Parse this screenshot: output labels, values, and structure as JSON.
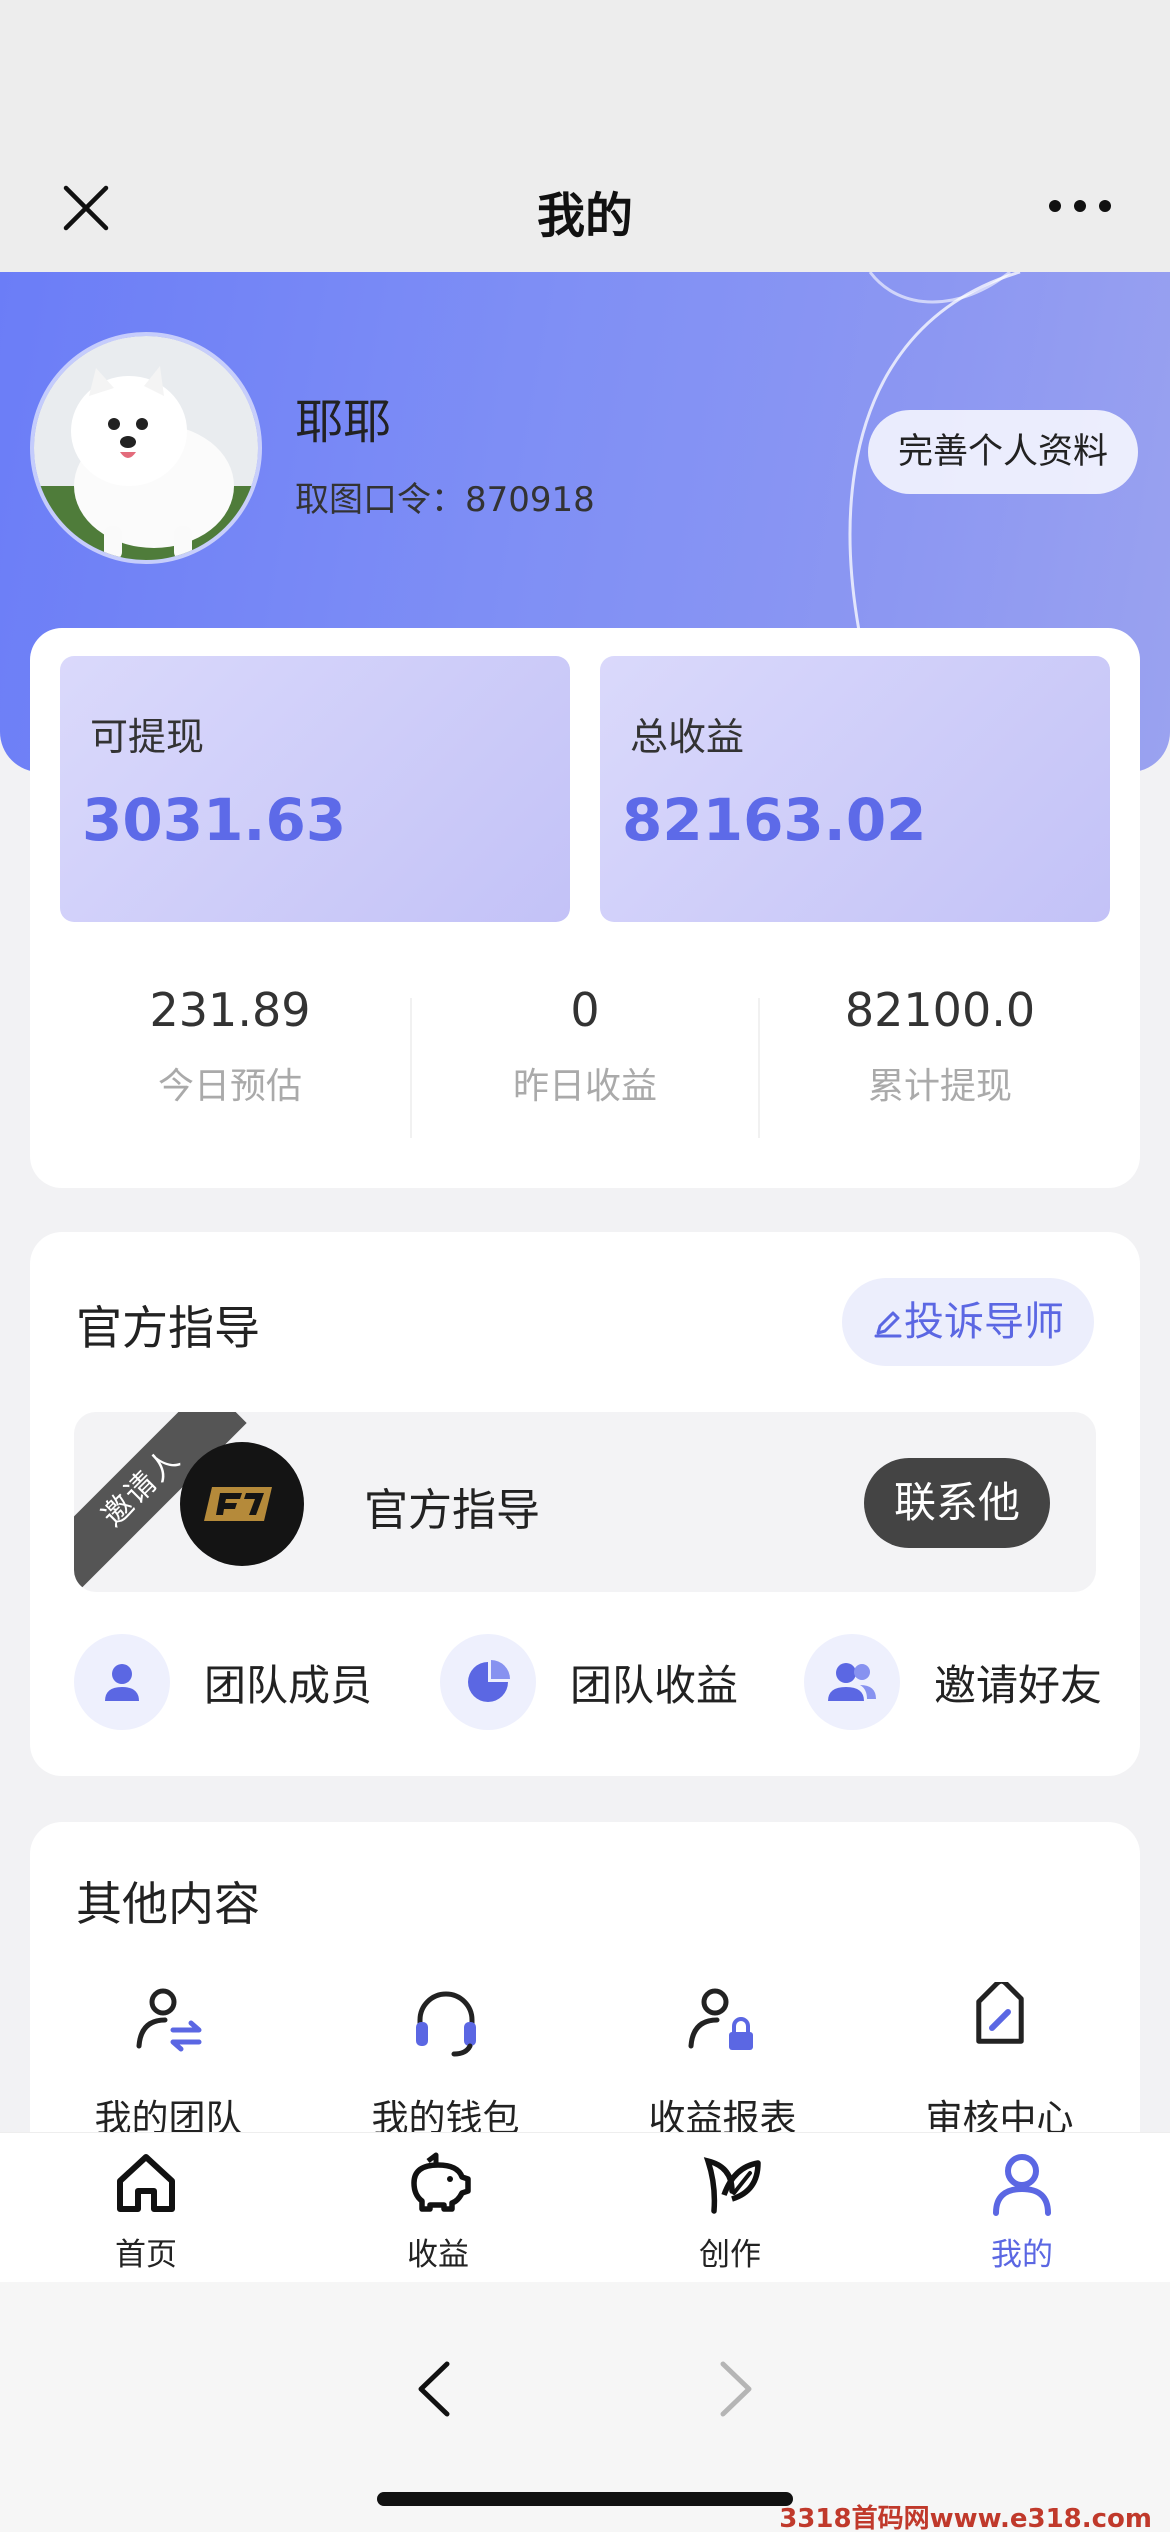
{
  "nav": {
    "title": "我的"
  },
  "profile": {
    "name": "耶耶",
    "code_label": "取图口令：",
    "code_value": "870918",
    "edit_button": "完善个人资料"
  },
  "earnings": {
    "withdrawable": {
      "label": "可提现",
      "value": "3031.63"
    },
    "total": {
      "label": "总收益",
      "value": "82163.02"
    },
    "stats": [
      {
        "value": "231.89",
        "label": "今日预估"
      },
      {
        "value": "0",
        "label": "昨日收益"
      },
      {
        "value": "82100.0",
        "label": "累计提现"
      }
    ]
  },
  "guide": {
    "title": "官方指导",
    "complain_button": "投诉导师",
    "inviter_badge": "邀请人",
    "mentor_name": "官方指导",
    "contact_button": "联系他",
    "team_items": [
      {
        "label": "团队成员",
        "icon": "person-icon"
      },
      {
        "label": "团队收益",
        "icon": "pie-chart-icon"
      },
      {
        "label": "邀请好友",
        "icon": "users-icon"
      }
    ]
  },
  "other": {
    "title": "其他内容",
    "items": [
      {
        "label": "我的团队",
        "icon": "team-transfer-icon"
      },
      {
        "label": "我的钱包",
        "icon": "headset-icon"
      },
      {
        "label": "收益报表",
        "icon": "user-lock-icon"
      },
      {
        "label": "审核中心",
        "icon": "tag-icon"
      }
    ]
  },
  "tabs": [
    {
      "label": "首页",
      "icon": "home-icon"
    },
    {
      "label": "收益",
      "icon": "piggy-bank-icon"
    },
    {
      "label": "创作",
      "icon": "leaf-icon"
    },
    {
      "label": "我的",
      "icon": "user-icon",
      "active": true
    }
  ],
  "watermark": "3318首码网www.e318.com",
  "colors": {
    "accent": "#5b67e3",
    "hero_start": "#6b7df7",
    "hero_end": "#9aa2f0"
  }
}
